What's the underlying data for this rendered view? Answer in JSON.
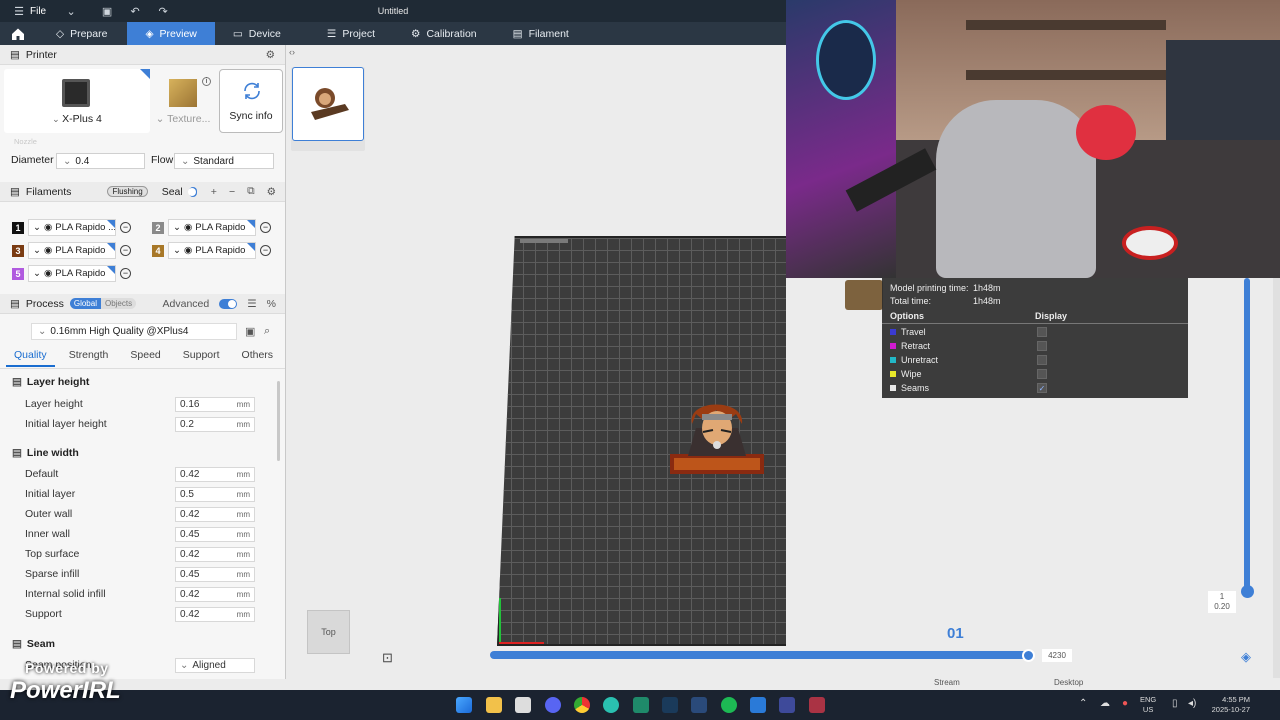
{
  "titlebar": {
    "file_label": "File",
    "title": "Untitled"
  },
  "nav": {
    "tabs": [
      {
        "label": "Prepare",
        "icon": "cube-icon"
      },
      {
        "label": "Preview",
        "icon": "layers-icon",
        "active": true
      },
      {
        "label": "Device",
        "icon": "monitor-icon"
      },
      {
        "label": "Project",
        "icon": "sliders-icon"
      },
      {
        "label": "Calibration",
        "icon": "gear-icon"
      },
      {
        "label": "Filament",
        "icon": "spool-icon"
      }
    ]
  },
  "printer": {
    "section_label": "Printer",
    "name": "X-Plus 4",
    "plate_label": "Texture...",
    "sync_label": "Sync info",
    "nozzle_label": "Nozzle",
    "diameter_label": "Diameter",
    "diameter_value": "0.4",
    "flow_label": "Flow",
    "flow_value": "Standard"
  },
  "filaments": {
    "section_label": "Filaments",
    "flushing_label": "Flushing",
    "seal_label": "Seal",
    "items": [
      {
        "num": "1",
        "name": "PLA Rapido ...",
        "color": "#111111"
      },
      {
        "num": "2",
        "name": "PLA Rapido",
        "color": "#8a8a8a"
      },
      {
        "num": "3",
        "name": "PLA Rapido",
        "color": "#7a3b12"
      },
      {
        "num": "4",
        "name": "PLA Rapido",
        "color": "#a87828"
      },
      {
        "num": "5",
        "name": "PLA Rapido",
        "color": "#b05adf"
      }
    ]
  },
  "process": {
    "section_label": "Process",
    "global_label": "Global",
    "objects_label": "Objects",
    "advanced_label": "Advanced",
    "profile": "0.16mm High Quality @XPlus4",
    "tabs": [
      "Quality",
      "Strength",
      "Speed",
      "Support",
      "Others"
    ],
    "groups": {
      "layer_height": {
        "title": "Layer height",
        "rows": [
          {
            "label": "Layer height",
            "value": "0.16",
            "unit": "mm"
          },
          {
            "label": "Initial layer height",
            "value": "0.2",
            "unit": "mm"
          }
        ]
      },
      "line_width": {
        "title": "Line width",
        "rows": [
          {
            "label": "Default",
            "value": "0.42",
            "unit": "mm"
          },
          {
            "label": "Initial layer",
            "value": "0.5",
            "unit": "mm"
          },
          {
            "label": "Outer wall",
            "value": "0.42",
            "unit": "mm"
          },
          {
            "label": "Inner wall",
            "value": "0.45",
            "unit": "mm"
          },
          {
            "label": "Top surface",
            "value": "0.42",
            "unit": "mm"
          },
          {
            "label": "Sparse infill",
            "value": "0.45",
            "unit": "mm"
          },
          {
            "label": "Internal solid infill",
            "value": "0.42",
            "unit": "mm"
          },
          {
            "label": "Support",
            "value": "0.42",
            "unit": "mm"
          }
        ]
      },
      "seam": {
        "title": "Seam",
        "rows": [
          {
            "label": "Seam position",
            "value": "Aligned"
          }
        ]
      }
    }
  },
  "viewport": {
    "view_label": "Top",
    "plate_number": "01",
    "slider_value": "4230",
    "layer_top": "1",
    "layer_bottom": "0.20"
  },
  "stats": {
    "model_time_label": "Model printing time:",
    "model_time": "1h48m",
    "total_time_label": "Total time:",
    "total_time": "1h48m",
    "options_header": "Options",
    "display_header": "Display",
    "options": [
      {
        "label": "Travel",
        "color": "#3b3bd1",
        "checked": false
      },
      {
        "label": "Retract",
        "color": "#d11bd1",
        "checked": false
      },
      {
        "label": "Unretract",
        "color": "#22b8c8",
        "checked": false
      },
      {
        "label": "Wipe",
        "color": "#e8e82a",
        "checked": false
      },
      {
        "label": "Seams",
        "color": "#e8e8e8",
        "checked": true
      }
    ]
  },
  "overlay": {
    "watermark": "Powered by",
    "brand": "PowerIRL",
    "stream_label": "Stream",
    "desktop_label": "Desktop"
  },
  "taskbar": {
    "lang_top": "ENG",
    "lang_bottom": "US",
    "time": "4:55 PM",
    "date": "2025-10-27"
  }
}
